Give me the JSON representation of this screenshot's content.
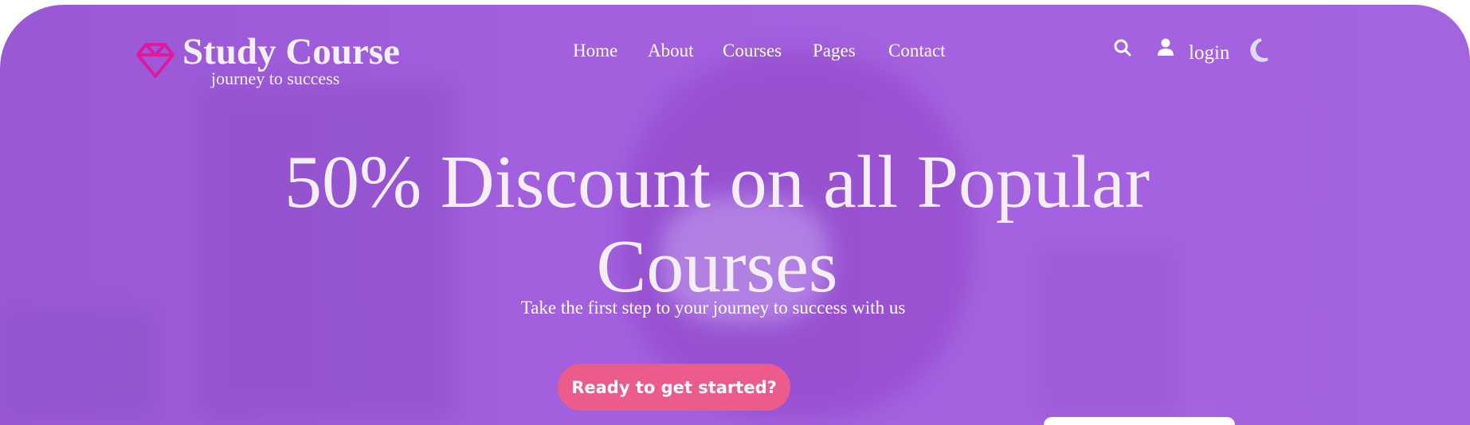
{
  "brand": {
    "name": "Study Course",
    "tagline": "journey to success"
  },
  "nav": [
    "Home",
    "About",
    "Courses",
    "Pages",
    "Contact"
  ],
  "header_actions": {
    "search_icon": "search-icon",
    "user_icon": "user-icon",
    "login_label": "login",
    "theme_icon": "moon-icon"
  },
  "hero": {
    "title": "50% Discount on all Popular Courses",
    "subtitle": "Take the first step to your journey to success with us",
    "cta_label": "Ready to get started?"
  },
  "colors": {
    "overlay": "#a260de",
    "accent": "#ec5c8a",
    "logo": "#e0189a"
  }
}
